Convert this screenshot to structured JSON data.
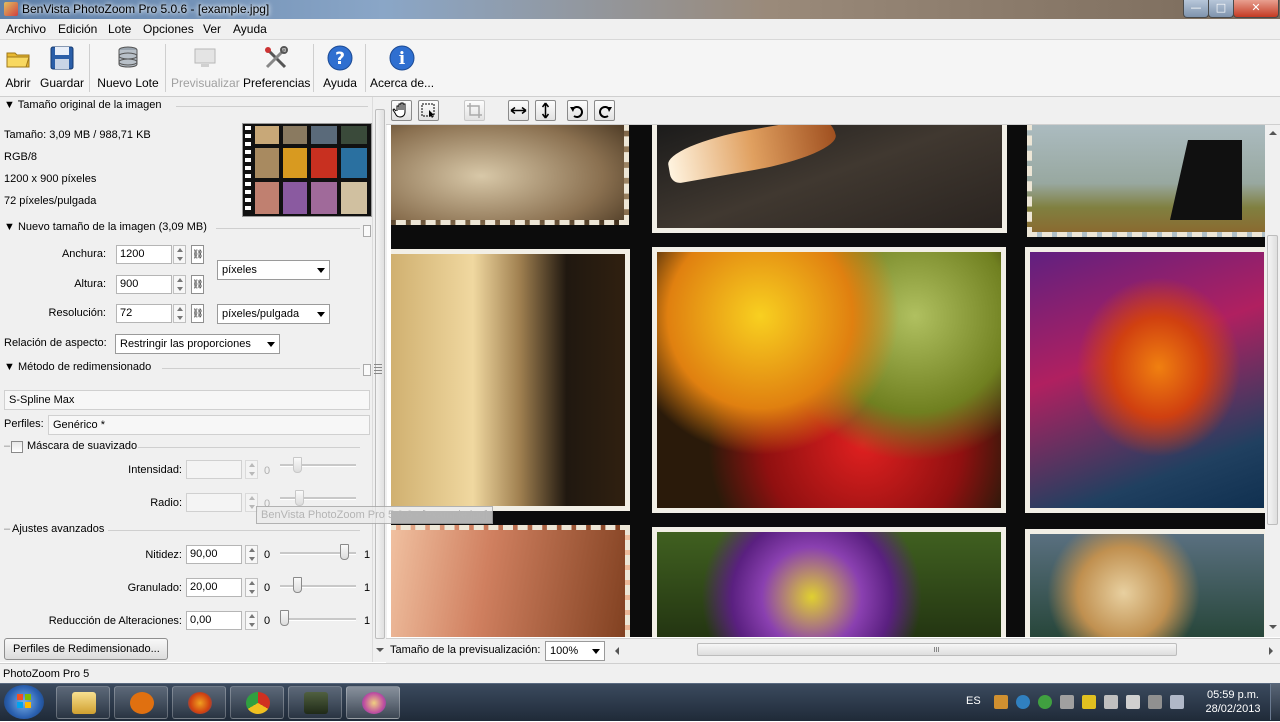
{
  "window": {
    "title": "BenVista PhotoZoom Pro 5.0.6 - [example.jpg]",
    "min_glyph": "—",
    "max_glyph": "□",
    "close_glyph": "✕"
  },
  "menu": [
    "Archivo",
    "Edición",
    "Lote",
    "Opciones",
    "Ver",
    "Ayuda"
  ],
  "toolbar": {
    "open": "Abrir",
    "save": "Guardar",
    "new_batch": "Nuevo Lote",
    "preview": "Previsualizar",
    "preferences": "Preferencias",
    "help": "Ayuda",
    "about": "Acerca de..."
  },
  "original": {
    "heading": "Tamaño original de la imagen",
    "size": "Tamaño: 3,09 MB / 988,71 KB",
    "mode": "RGB/8",
    "dims": "1200 x 900 píxeles",
    "res": "72 píxeles/pulgada"
  },
  "newsize": {
    "heading": "Nuevo tamaño de la imagen (3,09 MB)",
    "width_label": "Anchura:",
    "width": "1200",
    "height_label": "Altura:",
    "height": "900",
    "unit": "píxeles",
    "res_label": "Resolución:",
    "res": "72",
    "res_unit": "píxeles/pulgada",
    "aspect_label": "Relación de aspecto:",
    "aspect": "Restringir las proporciones",
    "link_glyph": "⛓"
  },
  "method": {
    "heading": "Método de redimensionado",
    "method": "S-Spline Max",
    "profiles_label": "Perfiles:",
    "profile": "Genérico *",
    "unsharp_label": "Máscara de suavizado",
    "intensity_label": "Intensidad:",
    "radius_label": "Radio:",
    "zero": "0"
  },
  "advanced": {
    "heading": "Ajustes avanzados",
    "sharpness_label": "Nitidez:",
    "sharpness": "90,00",
    "grain_label": "Granulado:",
    "grain": "20,00",
    "artifact_label": "Reducción de Alteraciones:",
    "artifact": "0,00",
    "min": "0",
    "max": "1",
    "sharpness_level": 0.9,
    "grain_level": 0.2,
    "artifact_level": 0.0
  },
  "profiles_button": "Perfiles de Redimensionado...",
  "tooltip": "BenVista PhotoZoom Pro 5.0.6 - [example.jpg]",
  "preview_size": {
    "label": "Tamaño de la previsualización:",
    "value": "100%"
  },
  "status": "PhotoZoom Pro 5",
  "tray": {
    "lang": "ES",
    "time": "05:59 p.m.",
    "date": "28/02/2013"
  },
  "colors": {
    "close_red": "#c43a22",
    "taskbar": "#2a3646"
  }
}
